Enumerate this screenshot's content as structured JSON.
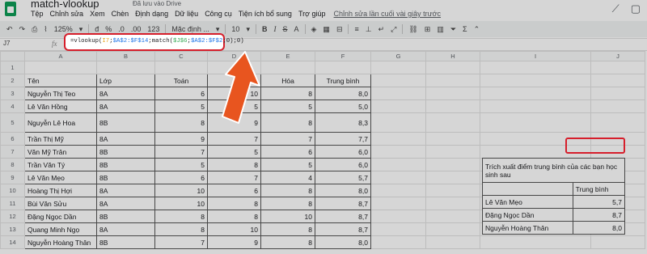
{
  "doc": {
    "title": "match-vlookup",
    "saved_status": "Đã lưu vào Drive"
  },
  "menu": [
    "Tệp",
    "Chỉnh sửa",
    "Xem",
    "Chèn",
    "Định dạng",
    "Dữ liệu",
    "Công cụ",
    "Tiện ích bổ sung",
    "Trợ giúp"
  ],
  "last_edit": "Chỉnh sửa lần cuối vài giây trước",
  "toolbar": {
    "zoom": "125%",
    "currency": "đ",
    "percent": "%",
    "dec_decrease": ".0",
    "dec_increase": ".00",
    "more_formats": "123",
    "font": "Mặc định ...",
    "font_size": "10",
    "bold": "B",
    "italic": "I",
    "strike": "S",
    "text_color": "A"
  },
  "name_box": "J7",
  "formula": {
    "p1": "=vlookup(",
    "p2": "I7",
    "p3": ";",
    "p4": "$A$2:$F$14",
    "p5": ";match(",
    "p6": "$J$6",
    "p7": ";",
    "p8": "$A$2:$F$2",
    "p9": ";0);0)"
  },
  "columns": [
    "A",
    "B",
    "C",
    "D",
    "E",
    "F",
    "G",
    "H",
    "I",
    "J"
  ],
  "rows": [
    {
      "n": "1",
      "cells": [
        "",
        "",
        "",
        "",
        "",
        "",
        "",
        "",
        "",
        ""
      ]
    },
    {
      "n": "2",
      "cells": [
        "Tên",
        "Lớp",
        "Toán",
        "",
        "Hóa",
        "Trung bình",
        "",
        "",
        "",
        ""
      ]
    },
    {
      "n": "3",
      "cells": [
        "Nguyễn Thị Teo",
        "8A",
        "6",
        "10",
        "8",
        "8,0",
        "",
        "",
        "",
        ""
      ]
    },
    {
      "n": "4",
      "cells": [
        "Lê Văn Hồng",
        "8A",
        "5",
        "5",
        "5",
        "5,0",
        "",
        "",
        "",
        ""
      ]
    },
    {
      "n": "5",
      "cells": [
        "Nguyễn Lê Hoa",
        "8B",
        "8",
        "9",
        "8",
        "8,3",
        "",
        "",
        "",
        ""
      ]
    },
    {
      "n": "6",
      "cells": [
        "Trần Thị Mỹ",
        "8A",
        "9",
        "7",
        "7",
        "7,7",
        "",
        "",
        "",
        ""
      ]
    },
    {
      "n": "7",
      "cells": [
        "Văn Mỹ Trân",
        "8B",
        "7",
        "5",
        "6",
        "6,0",
        "",
        "",
        "",
        ""
      ]
    },
    {
      "n": "8",
      "cells": [
        "Trần Văn Tý",
        "8B",
        "5",
        "8",
        "5",
        "6,0",
        "",
        "",
        "",
        ""
      ]
    },
    {
      "n": "9",
      "cells": [
        "Lê Văn Mẹo",
        "8B",
        "6",
        "7",
        "4",
        "5,7",
        "",
        "",
        "",
        ""
      ]
    },
    {
      "n": "10",
      "cells": [
        "Hoàng Thị Hợi",
        "8A",
        "10",
        "6",
        "8",
        "8,0",
        "",
        "",
        "",
        ""
      ]
    },
    {
      "n": "11",
      "cells": [
        "Bùi Văn Sửu",
        "8A",
        "10",
        "8",
        "8",
        "8,7",
        "",
        "",
        "",
        ""
      ]
    },
    {
      "n": "12",
      "cells": [
        "Đặng Ngọc Dần",
        "8B",
        "8",
        "8",
        "10",
        "8,7",
        "",
        "",
        "",
        ""
      ]
    },
    {
      "n": "13",
      "cells": [
        "Quang Minh Ngọ",
        "8A",
        "8",
        "10",
        "8",
        "8,7",
        "",
        "",
        "",
        ""
      ]
    },
    {
      "n": "14",
      "cells": [
        "Nguyễn Hoàng Thân",
        "8B",
        "7",
        "9",
        "8",
        "8,0",
        "",
        "",
        "",
        ""
      ]
    }
  ],
  "panel": {
    "title": "Trích xuất điểm trung bình của các bạn học sinh sau",
    "header": "Trung bình",
    "items": [
      {
        "name": "Lê Văn Mẹo",
        "value": "5,7"
      },
      {
        "name": "Đặng Ngọc Dần",
        "value": "8,7"
      },
      {
        "name": "Nguyễn Hoàng Thân",
        "value": "8,0"
      }
    ]
  },
  "colors": {
    "highlight": "#d61e2b",
    "arrow": "#e8551f"
  }
}
